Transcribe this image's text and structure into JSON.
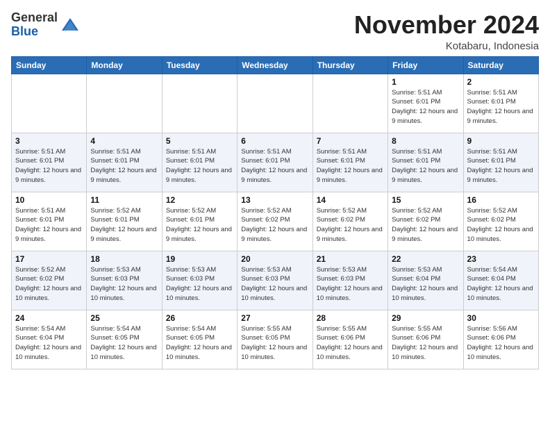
{
  "header": {
    "logo_general": "General",
    "logo_blue": "Blue",
    "month_title": "November 2024",
    "subtitle": "Kotabaru, Indonesia"
  },
  "days_of_week": [
    "Sunday",
    "Monday",
    "Tuesday",
    "Wednesday",
    "Thursday",
    "Friday",
    "Saturday"
  ],
  "weeks": [
    [
      {
        "day": "",
        "info": ""
      },
      {
        "day": "",
        "info": ""
      },
      {
        "day": "",
        "info": ""
      },
      {
        "day": "",
        "info": ""
      },
      {
        "day": "",
        "info": ""
      },
      {
        "day": "1",
        "info": "Sunrise: 5:51 AM\nSunset: 6:01 PM\nDaylight: 12 hours\nand 9 minutes."
      },
      {
        "day": "2",
        "info": "Sunrise: 5:51 AM\nSunset: 6:01 PM\nDaylight: 12 hours\nand 9 minutes."
      }
    ],
    [
      {
        "day": "3",
        "info": "Sunrise: 5:51 AM\nSunset: 6:01 PM\nDaylight: 12 hours\nand 9 minutes."
      },
      {
        "day": "4",
        "info": "Sunrise: 5:51 AM\nSunset: 6:01 PM\nDaylight: 12 hours\nand 9 minutes."
      },
      {
        "day": "5",
        "info": "Sunrise: 5:51 AM\nSunset: 6:01 PM\nDaylight: 12 hours\nand 9 minutes."
      },
      {
        "day": "6",
        "info": "Sunrise: 5:51 AM\nSunset: 6:01 PM\nDaylight: 12 hours\nand 9 minutes."
      },
      {
        "day": "7",
        "info": "Sunrise: 5:51 AM\nSunset: 6:01 PM\nDaylight: 12 hours\nand 9 minutes."
      },
      {
        "day": "8",
        "info": "Sunrise: 5:51 AM\nSunset: 6:01 PM\nDaylight: 12 hours\nand 9 minutes."
      },
      {
        "day": "9",
        "info": "Sunrise: 5:51 AM\nSunset: 6:01 PM\nDaylight: 12 hours\nand 9 minutes."
      }
    ],
    [
      {
        "day": "10",
        "info": "Sunrise: 5:51 AM\nSunset: 6:01 PM\nDaylight: 12 hours\nand 9 minutes."
      },
      {
        "day": "11",
        "info": "Sunrise: 5:52 AM\nSunset: 6:01 PM\nDaylight: 12 hours\nand 9 minutes."
      },
      {
        "day": "12",
        "info": "Sunrise: 5:52 AM\nSunset: 6:01 PM\nDaylight: 12 hours\nand 9 minutes."
      },
      {
        "day": "13",
        "info": "Sunrise: 5:52 AM\nSunset: 6:02 PM\nDaylight: 12 hours\nand 9 minutes."
      },
      {
        "day": "14",
        "info": "Sunrise: 5:52 AM\nSunset: 6:02 PM\nDaylight: 12 hours\nand 9 minutes."
      },
      {
        "day": "15",
        "info": "Sunrise: 5:52 AM\nSunset: 6:02 PM\nDaylight: 12 hours\nand 9 minutes."
      },
      {
        "day": "16",
        "info": "Sunrise: 5:52 AM\nSunset: 6:02 PM\nDaylight: 12 hours\nand 10 minutes."
      }
    ],
    [
      {
        "day": "17",
        "info": "Sunrise: 5:52 AM\nSunset: 6:02 PM\nDaylight: 12 hours\nand 10 minutes."
      },
      {
        "day": "18",
        "info": "Sunrise: 5:53 AM\nSunset: 6:03 PM\nDaylight: 12 hours\nand 10 minutes."
      },
      {
        "day": "19",
        "info": "Sunrise: 5:53 AM\nSunset: 6:03 PM\nDaylight: 12 hours\nand 10 minutes."
      },
      {
        "day": "20",
        "info": "Sunrise: 5:53 AM\nSunset: 6:03 PM\nDaylight: 12 hours\nand 10 minutes."
      },
      {
        "day": "21",
        "info": "Sunrise: 5:53 AM\nSunset: 6:03 PM\nDaylight: 12 hours\nand 10 minutes."
      },
      {
        "day": "22",
        "info": "Sunrise: 5:53 AM\nSunset: 6:04 PM\nDaylight: 12 hours\nand 10 minutes."
      },
      {
        "day": "23",
        "info": "Sunrise: 5:54 AM\nSunset: 6:04 PM\nDaylight: 12 hours\nand 10 minutes."
      }
    ],
    [
      {
        "day": "24",
        "info": "Sunrise: 5:54 AM\nSunset: 6:04 PM\nDaylight: 12 hours\nand 10 minutes."
      },
      {
        "day": "25",
        "info": "Sunrise: 5:54 AM\nSunset: 6:05 PM\nDaylight: 12 hours\nand 10 minutes."
      },
      {
        "day": "26",
        "info": "Sunrise: 5:54 AM\nSunset: 6:05 PM\nDaylight: 12 hours\nand 10 minutes."
      },
      {
        "day": "27",
        "info": "Sunrise: 5:55 AM\nSunset: 6:05 PM\nDaylight: 12 hours\nand 10 minutes."
      },
      {
        "day": "28",
        "info": "Sunrise: 5:55 AM\nSunset: 6:06 PM\nDaylight: 12 hours\nand 10 minutes."
      },
      {
        "day": "29",
        "info": "Sunrise: 5:55 AM\nSunset: 6:06 PM\nDaylight: 12 hours\nand 10 minutes."
      },
      {
        "day": "30",
        "info": "Sunrise: 5:56 AM\nSunset: 6:06 PM\nDaylight: 12 hours\nand 10 minutes."
      }
    ]
  ]
}
